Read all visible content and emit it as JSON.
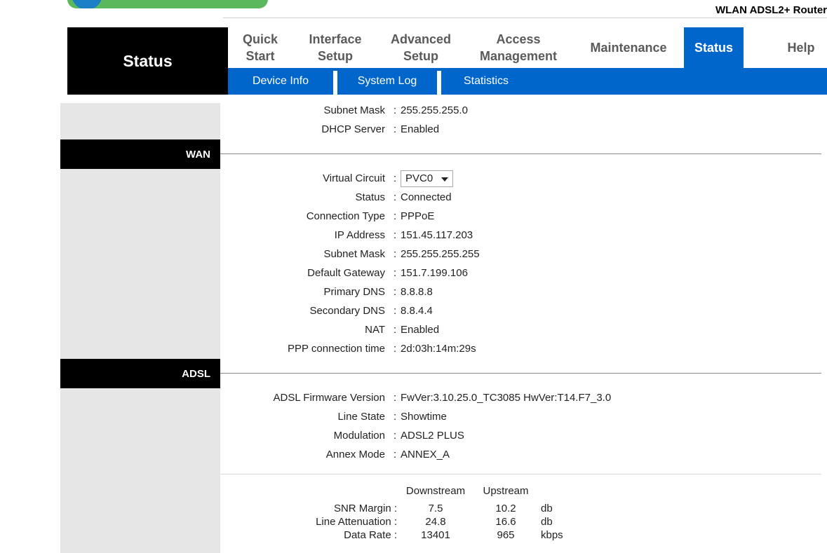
{
  "header": {
    "product_name": "WLAN ADSL2+ Router",
    "section_title": "Status"
  },
  "nav": {
    "items": [
      {
        "label": "Quick\nStart"
      },
      {
        "label": "Interface\nSetup"
      },
      {
        "label": "Advanced\nSetup"
      },
      {
        "label": "Access\nManagement"
      },
      {
        "label": "Maintenance"
      },
      {
        "label": "Status"
      },
      {
        "label": "Help"
      }
    ],
    "active": "Status"
  },
  "subnav": {
    "items": [
      "Device Info",
      "System Log",
      "Statistics"
    ]
  },
  "lan": {
    "rows": [
      {
        "label": "Subnet Mask",
        "value": "255.255.255.0"
      },
      {
        "label": "DHCP Server",
        "value": "Enabled"
      }
    ]
  },
  "wan": {
    "title": "WAN",
    "virtual_circuit_label": "Virtual Circuit",
    "virtual_circuit_value": "PVC0",
    "rows": [
      {
        "label": "Status",
        "value": "Connected"
      },
      {
        "label": "Connection Type",
        "value": "PPPoE"
      },
      {
        "label": "IP Address",
        "value": "151.45.117.203"
      },
      {
        "label": "Subnet Mask",
        "value": "255.255.255.255"
      },
      {
        "label": "Default Gateway",
        "value": "151.7.199.106"
      },
      {
        "label": "Primary DNS",
        "value": "8.8.8.8"
      },
      {
        "label": "Secondary DNS",
        "value": "8.8.4.4"
      },
      {
        "label": "NAT",
        "value": "Enabled"
      },
      {
        "label": "PPP connection time",
        "value": "2d:03h:14m:29s"
      }
    ]
  },
  "adsl": {
    "title": "ADSL",
    "rows": [
      {
        "label": "ADSL Firmware Version",
        "value": "FwVer:3.10.25.0_TC3085 HwVer:T14.F7_3.0"
      },
      {
        "label": "Line State",
        "value": "Showtime"
      },
      {
        "label": "Modulation",
        "value": "ADSL2 PLUS"
      },
      {
        "label": "Annex Mode",
        "value": "ANNEX_A"
      }
    ],
    "stats": {
      "headers": [
        "Downstream",
        "Upstream"
      ],
      "rows": [
        {
          "label": "SNR Margin :",
          "down": "7.5",
          "up": "10.2",
          "unit": "db"
        },
        {
          "label": "Line Attenuation :",
          "down": "24.8",
          "up": "16.6",
          "unit": "db"
        },
        {
          "label": "Data Rate :",
          "down": "13401",
          "up": "965",
          "unit": "kbps"
        }
      ]
    }
  },
  "colors": {
    "accent_blue": "#0066cc",
    "section_black": "#000000",
    "sidebar_gray": "#e6e6e6",
    "logo_green": "#5cb85c"
  },
  "icons": {
    "logo": "brand-logo",
    "dropdown": "chevron-down-icon"
  }
}
